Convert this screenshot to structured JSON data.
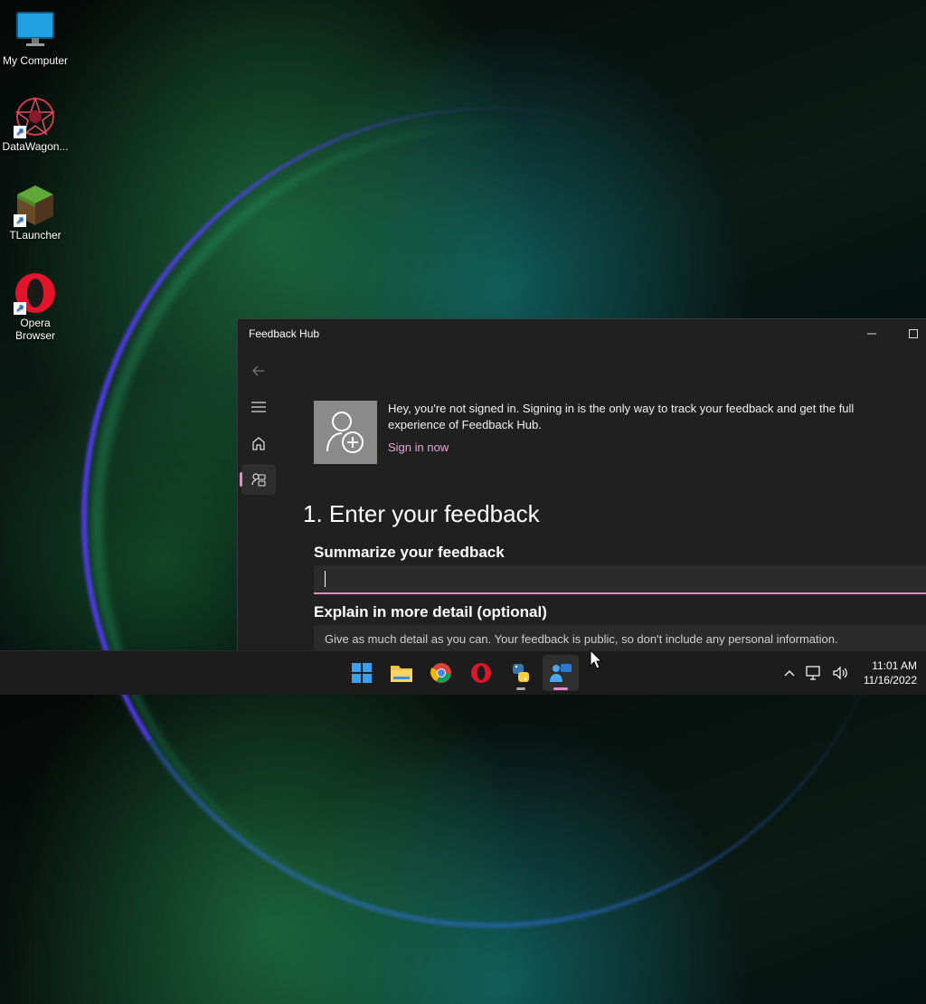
{
  "desktop": {
    "icons": [
      {
        "label": "My Computer",
        "icon": "monitor-icon"
      },
      {
        "label": "DataWagon...",
        "icon": "datawagon-icon"
      },
      {
        "label": "TLauncher",
        "icon": "minecraft-block-icon"
      },
      {
        "label": "Opera Browser",
        "icon": "opera-icon"
      }
    ]
  },
  "window": {
    "title": "Feedback Hub",
    "signin_message": "Hey, you're not signed in. Signing in is the only way to track your feedback and get the full experience of Feedback Hub.",
    "signin_link": "Sign in now",
    "heading": "1. Enter your feedback",
    "summary_label": "Summarize your feedback",
    "summary_value": "",
    "detail_label": "Explain in more detail (optional)",
    "detail_placeholder": "Give as much detail as you can. Your feedback is public, so don't include any personal information."
  },
  "taskbar": {
    "apps": [
      "start-icon",
      "file-explorer-icon",
      "chrome-icon",
      "opera-icon",
      "python-icon",
      "feedback-hub-icon"
    ],
    "time": "11:01 AM",
    "date": "11/16/2022"
  },
  "colors": {
    "accent": "#e48ac9",
    "window_bg": "#202020"
  }
}
